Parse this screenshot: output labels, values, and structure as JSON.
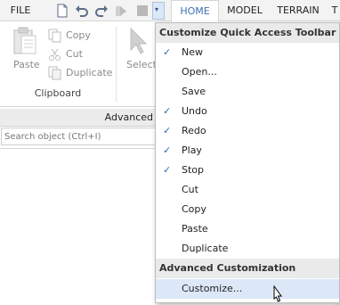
{
  "topbar": {
    "file_label": "FILE",
    "tabs": [
      "HOME",
      "MODEL",
      "TERRAIN",
      "T"
    ],
    "active_tab": "HOME"
  },
  "qat": {
    "icons": [
      "new-file-icon",
      "undo-icon",
      "redo-icon",
      "play-icon",
      "stop-icon"
    ],
    "dropdown_icon": "customize-dropdown-icon"
  },
  "ribbon": {
    "paste_label": "Paste",
    "copy_label": "Copy",
    "cut_label": "Cut",
    "duplicate_label": "Duplicate",
    "select_label": "Select",
    "clipboard_label": "Clipboard"
  },
  "panel": {
    "title": "Advanced",
    "search_placeholder": "Search object (Ctrl+I)"
  },
  "menu": {
    "header1": "Customize Quick Access Toolbar",
    "items": [
      {
        "label": "New",
        "checked": "✓"
      },
      {
        "label": "Open...",
        "checked": ""
      },
      {
        "label": "Save",
        "checked": ""
      },
      {
        "label": "Undo",
        "checked": "✓"
      },
      {
        "label": "Redo",
        "checked": "✓"
      },
      {
        "label": "Play",
        "checked": "✓"
      },
      {
        "label": "Stop",
        "checked": "✓"
      },
      {
        "label": "Cut",
        "checked": ""
      },
      {
        "label": "Copy",
        "checked": ""
      },
      {
        "label": "Paste",
        "checked": ""
      },
      {
        "label": "Duplicate",
        "checked": ""
      }
    ],
    "header2": "Advanced Customization",
    "customize_label": "Customize..."
  },
  "colors": {
    "accent": "#3b72b5",
    "hover": "#dce8f8"
  }
}
